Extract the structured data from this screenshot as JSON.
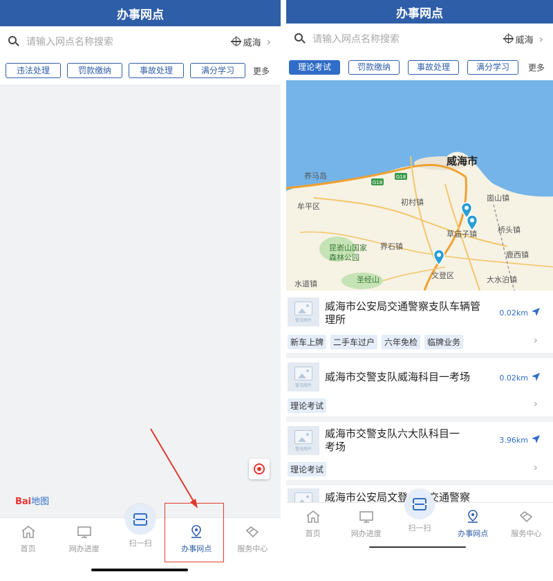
{
  "left_screen": {
    "title": "办事网点",
    "search": {
      "placeholder": "请输入网点名称搜索",
      "city": "威海"
    },
    "tabs": [
      "违法处理",
      "罚款缴纳",
      "事故处理",
      "满分学习"
    ],
    "more_label": "更多",
    "map_logo": {
      "part1": "Bai",
      "part2": "地图"
    },
    "nav": [
      "首页",
      "网办进度",
      "扫一扫",
      "办事网点",
      "服务中心"
    ]
  },
  "right_screen": {
    "title": "办事网点",
    "search": {
      "placeholder": "请输入网点名称搜索",
      "city": "威海"
    },
    "tabs": [
      "理论考试",
      "罚款缴纳",
      "事故处理",
      "满分学习"
    ],
    "active_tab": "理论考试",
    "more_label": "更多",
    "map": {
      "labels": [
        "威海市",
        "养马岛",
        "牟平区",
        "初村镇",
        "崮山镇",
        "草庙子镇",
        "桥头镇",
        "昆嵛山国家",
        "森林公园",
        "界石镇",
        "鹿西镇",
        "圣经山",
        "文登区",
        "大水泊镇",
        "水道镇"
      ],
      "road_shields": [
        "G18",
        "G18"
      ]
    },
    "thumb_text": "暂无图片",
    "list": [
      {
        "title": "威海市公安局交通警察支队车辆管理所",
        "distance": "0.02km",
        "tags": [
          "新车上牌",
          "二手车过户",
          "六年免检",
          "临牌业务"
        ]
      },
      {
        "title": "威海市交警支队威海科目一考场",
        "distance": "0.02km",
        "tags": [
          "理论考试"
        ]
      },
      {
        "title": "威海市交警支队六大队科目一考场",
        "distance": "3.96km",
        "tags": [
          "理论考试"
        ]
      },
      {
        "title": "威海市公安局文登分局交通警察",
        "distance": "",
        "tags": []
      }
    ],
    "nav": [
      "首页",
      "网办进度",
      "扫一扫",
      "办事网点",
      "服务中心"
    ]
  },
  "colors": {
    "primary": "#2f5ea8",
    "accent": "#2f6dc6",
    "highlight": "#e0392d"
  }
}
